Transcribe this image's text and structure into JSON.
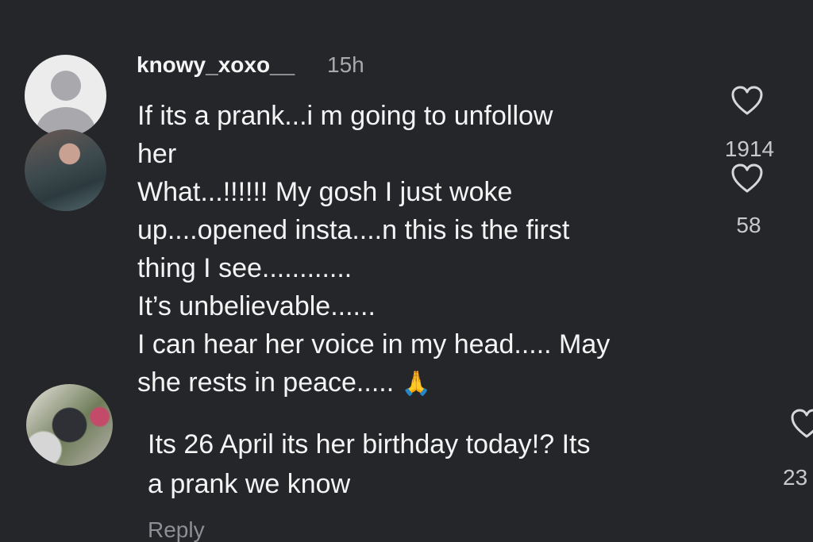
{
  "comments": [
    {
      "username": "knowy_xoxo__",
      "timestamp": "15h",
      "lines": [
        "If its a prank...i m going to unfollow",
        "her"
      ],
      "likes": "1914"
    },
    {
      "lines": [
        "What...!!!!!! My gosh I just woke",
        "up....opened insta....n this is the first",
        "thing I see............",
        "It’s unbelievable......",
        "I can hear her voice in my head..... May",
        "she rests in peace....."
      ],
      "emoji": "🙏",
      "likes": "58"
    },
    {
      "lines": [
        "Its 26 April its her birthday today!? Its",
        "a prank we know"
      ],
      "likes": "23",
      "reply_label": "Reply"
    }
  ],
  "icons": {
    "like": "heart-outline-icon",
    "avatar_default": "default-user-avatar",
    "emoji": "folded-hands"
  },
  "colors": {
    "background": "#25262a",
    "text": "#f4f4f4",
    "muted": "#a8a9ad"
  }
}
